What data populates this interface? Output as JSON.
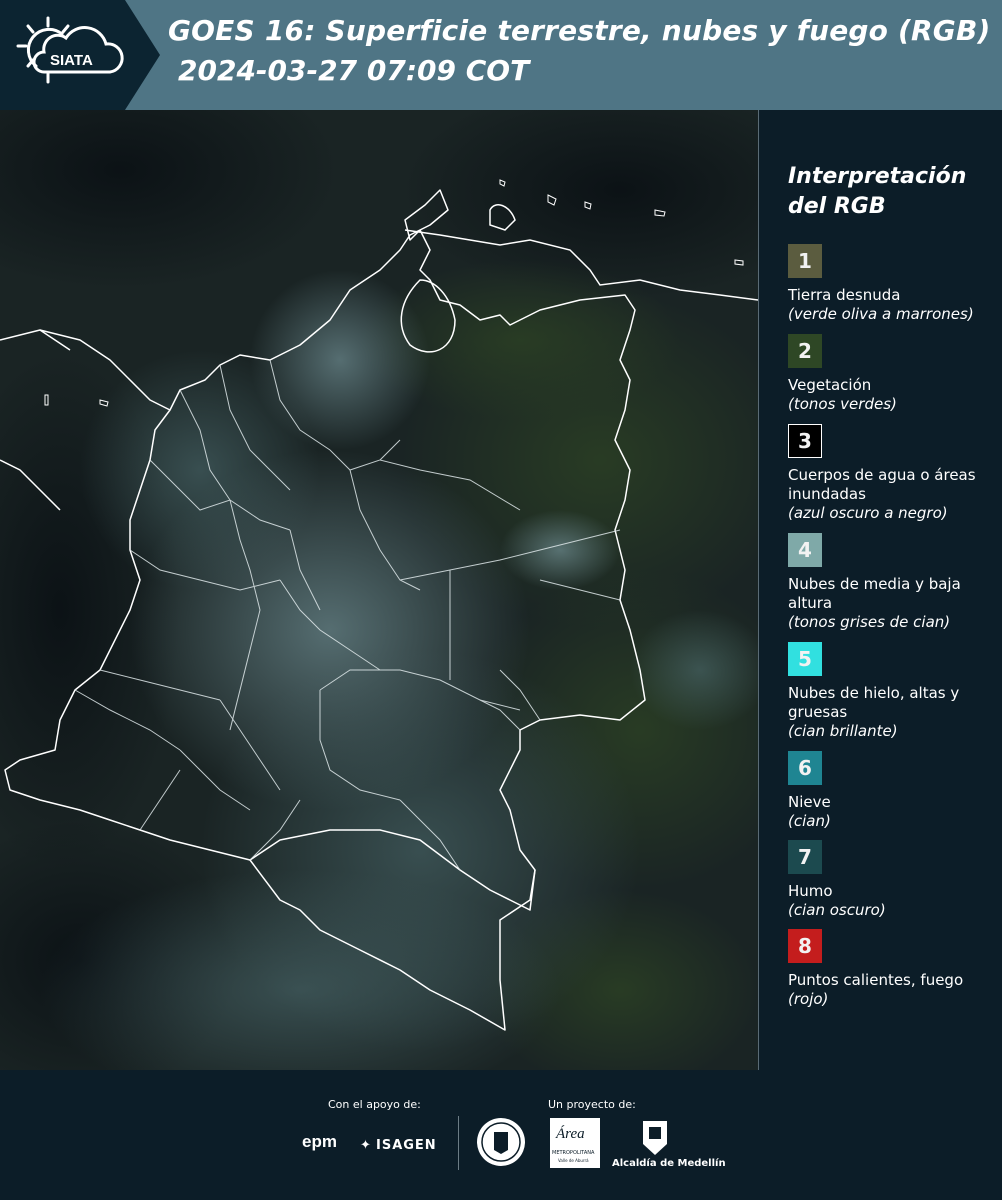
{
  "header": {
    "logo_text": "SIATA",
    "title": "GOES 16: Superficie terrestre, nubes y fuego (RGB)",
    "subtitle": "2024-03-27 07:09 COT"
  },
  "legend": {
    "title_line1": "Interpretación",
    "title_line2": "del RGB",
    "items": [
      {
        "num": "1",
        "label": "Tierra desnuda",
        "desc": "(verde oliva a marrones)",
        "color": "#5b5c3f"
      },
      {
        "num": "2",
        "label": "Vegetación",
        "desc": "(tonos verdes)",
        "color": "#2e4725"
      },
      {
        "num": "3",
        "label": "Cuerpos de agua o áreas inundadas",
        "desc": "(azul oscuro a negro)",
        "color": "#000000"
      },
      {
        "num": "4",
        "label": "Nubes de media y baja altura",
        "desc": "(tonos grises de cian)",
        "color": "#7fa9a8"
      },
      {
        "num": "5",
        "label": "Nubes de hielo, altas y gruesas",
        "desc": "(cian brillante)",
        "color": "#31e0e0"
      },
      {
        "num": "6",
        "label": "Nieve",
        "desc": "(cian)",
        "color": "#1f8592"
      },
      {
        "num": "7",
        "label": "Humo",
        "desc": "(cian oscuro)",
        "color": "#1c4a4f"
      },
      {
        "num": "8",
        "label": "Puntos calientes, fuego",
        "desc": "(rojo)",
        "color": "#c41d1d"
      }
    ]
  },
  "footer": {
    "support_label": "Con el apoyo de:",
    "project_label": "Un proyecto de:",
    "sponsor1": "epm",
    "sponsor2": "ISAGEN",
    "partner1": "Área",
    "partner1_sub": "METROPOLITANA",
    "partner1_sub2": "Valle de Aburrá",
    "partner2": "Alcaldía de Medellín"
  },
  "colors": {
    "header_bg": "#4f7585",
    "page_bg": "#0c1d28",
    "map_bg": "#15201f",
    "border_line": "#ffffff"
  }
}
